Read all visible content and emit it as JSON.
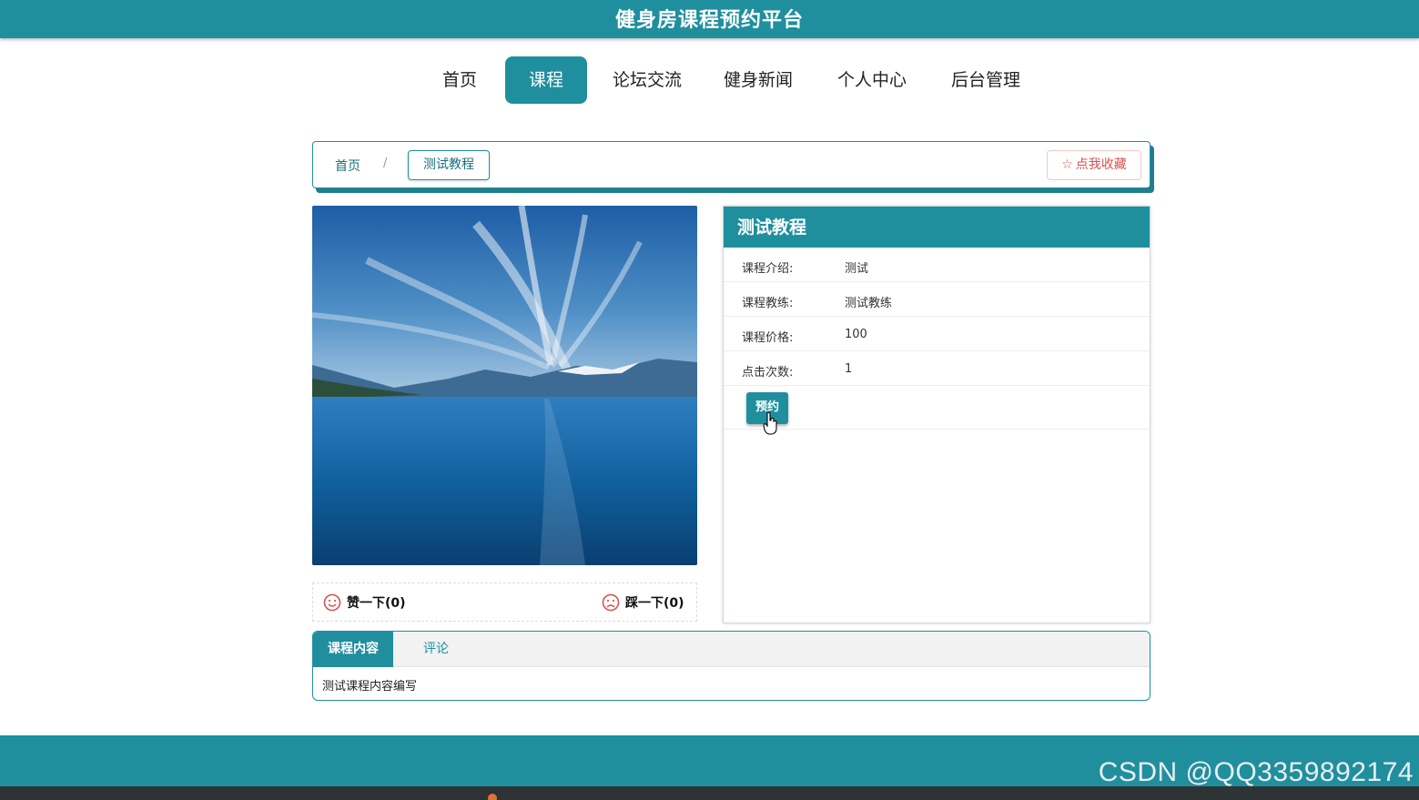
{
  "header": {
    "title": "健身房课程预约平台"
  },
  "nav": {
    "items": [
      {
        "label": "首页"
      },
      {
        "label": "课程"
      },
      {
        "label": "论坛交流"
      },
      {
        "label": "健身新闻"
      },
      {
        "label": "个人中心"
      },
      {
        "label": "后台管理"
      }
    ],
    "active": "课程"
  },
  "breadcrumb": {
    "home": "首页",
    "separator": "/",
    "current": "测试教程"
  },
  "favorite": {
    "star": "☆",
    "label": "点我收藏"
  },
  "votes": {
    "like": "赞一下(0)",
    "dislike": "踩一下(0)"
  },
  "course": {
    "title": "测试教程",
    "fields": [
      {
        "label": "课程介绍:",
        "value": "测试"
      },
      {
        "label": "课程教练:",
        "value": "测试教练"
      },
      {
        "label": "课程价格:",
        "value": "100"
      },
      {
        "label": "点击次数:",
        "value": "1"
      }
    ],
    "book_label": "预约"
  },
  "tabs": {
    "items": [
      {
        "label": "课程内容"
      },
      {
        "label": "评论"
      }
    ],
    "content": "测试课程内容编写"
  },
  "watermark": "CSDN @QQ3359892174",
  "colors": {
    "accent": "#1f8f9e",
    "danger": "#d9534f"
  },
  "icons": {
    "like": "smile-icon",
    "dislike": "frown-icon",
    "favorite": "star-icon",
    "cursor": "hand-cursor-icon"
  }
}
